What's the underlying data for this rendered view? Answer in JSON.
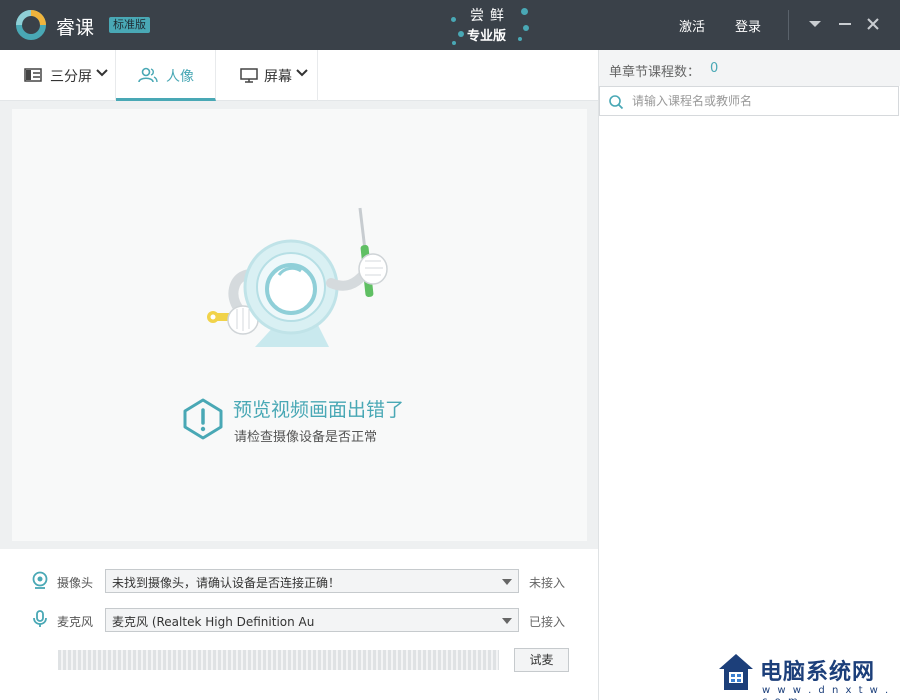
{
  "window": {
    "app_name": "睿课",
    "edition": "标准版",
    "trial_top": "尝鲜",
    "trial_bottom": "专业版",
    "activate": "激活",
    "login": "登录"
  },
  "tabs": [
    {
      "label": "三分屏",
      "icon": "layout-icon",
      "active": false
    },
    {
      "label": "人像",
      "icon": "users-icon",
      "active": true
    },
    {
      "label": "屏幕",
      "icon": "monitor-icon",
      "active": false
    }
  ],
  "preview": {
    "error_title": "预览视频画面出错了",
    "error_sub": "请检查摄像设备是否正常"
  },
  "devices": {
    "camera": {
      "label": "摄像头",
      "selected": "未找到摄像头，请确认设备是否连接正确！",
      "status": "未接入"
    },
    "mic": {
      "label": "麦克风",
      "selected": "麦克风 (Realtek High Definition Au",
      "status": "已接入"
    },
    "test_button": "试麦",
    "mic_level": 0
  },
  "sidebar": {
    "count_label": "单章节课程数：",
    "count_value": "0",
    "search_placeholder": "请输入课程名或教师名"
  },
  "watermark": {
    "text": "电脑系统网",
    "url": "w w w . d n x t w . c o m"
  },
  "colors": {
    "accent": "#49a8b5",
    "titlebar": "#3a4149"
  }
}
